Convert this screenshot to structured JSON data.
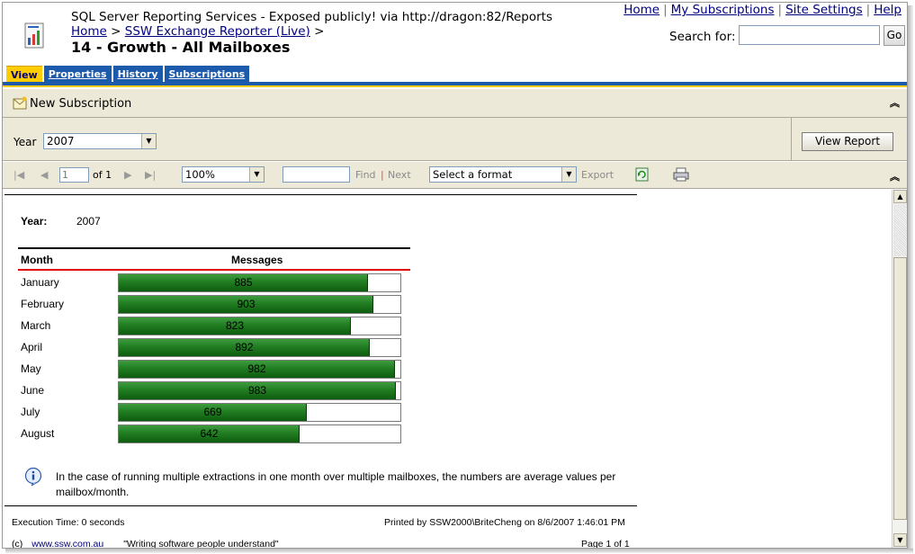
{
  "header": {
    "app_title": "SQL Server Reporting Services - Exposed publicly! via http://dragon:82/Reports",
    "breadcrumb": [
      {
        "label": "Home"
      },
      {
        "label": "SSW Exchange Reporter (Live)"
      }
    ],
    "breadcrumb_sep": ">",
    "page_title": "14 - Growth - All Mailboxes",
    "top_links": [
      "Home",
      "My Subscriptions",
      "Site Settings",
      "Help"
    ],
    "search_label": "Search for:",
    "search_value": "",
    "go_label": "Go"
  },
  "tabs": [
    {
      "label": "View",
      "active": true
    },
    {
      "label": "Properties",
      "active": false
    },
    {
      "label": "History",
      "active": false
    },
    {
      "label": "Subscriptions",
      "active": false
    }
  ],
  "subscription_bar": {
    "label": "New Subscription"
  },
  "parameters": {
    "year_label": "Year",
    "year_value": "2007",
    "view_report_label": "View Report"
  },
  "toolbar": {
    "page_value": "1",
    "page_of": "of 1",
    "zoom": "100%",
    "find_value": "",
    "find_label": "Find",
    "separator": "|",
    "next_label": "Next",
    "format_placeholder": "Select a format",
    "export_label": "Export"
  },
  "report": {
    "year_label": "Year:",
    "year_value": "2007",
    "col_month": "Month",
    "col_messages": "Messages",
    "bar_max": 1000,
    "rows": [
      {
        "month": "January",
        "messages": 885
      },
      {
        "month": "February",
        "messages": 903
      },
      {
        "month": "March",
        "messages": 823
      },
      {
        "month": "April",
        "messages": 892
      },
      {
        "month": "May",
        "messages": 982
      },
      {
        "month": "June",
        "messages": 983
      },
      {
        "month": "July",
        "messages": 669
      },
      {
        "month": "August",
        "messages": 642
      }
    ],
    "note": "In the case of running multiple extractions in one month over multiple mailboxes, the numbers are average values per mailbox/month.",
    "exec_time": "Execution Time: 0 seconds",
    "printed_by": "Printed by SSW2000\\BriteCheng on 8/6/2007 1:46:01 PM",
    "copyright": "(c)",
    "website": "www.ssw.com.au",
    "tagline": "\"Writing software people understand\"",
    "page_of": "Page 1 of 1"
  },
  "colors": {
    "bar_green": "#1f7a1f",
    "tab_blue": "#1c5aac",
    "tab_yellow": "#ffcc00",
    "link_navy": "#000080",
    "toolbar_bg": "#ece9d8",
    "header_rule_red": "#e00000"
  },
  "icons": [
    "report-app-icon",
    "new-subscription-icon",
    "collapse-chevrons-icon",
    "first-page-icon",
    "previous-page-icon",
    "next-page-icon",
    "last-page-icon",
    "refresh-icon",
    "print-icon",
    "info-icon"
  ]
}
